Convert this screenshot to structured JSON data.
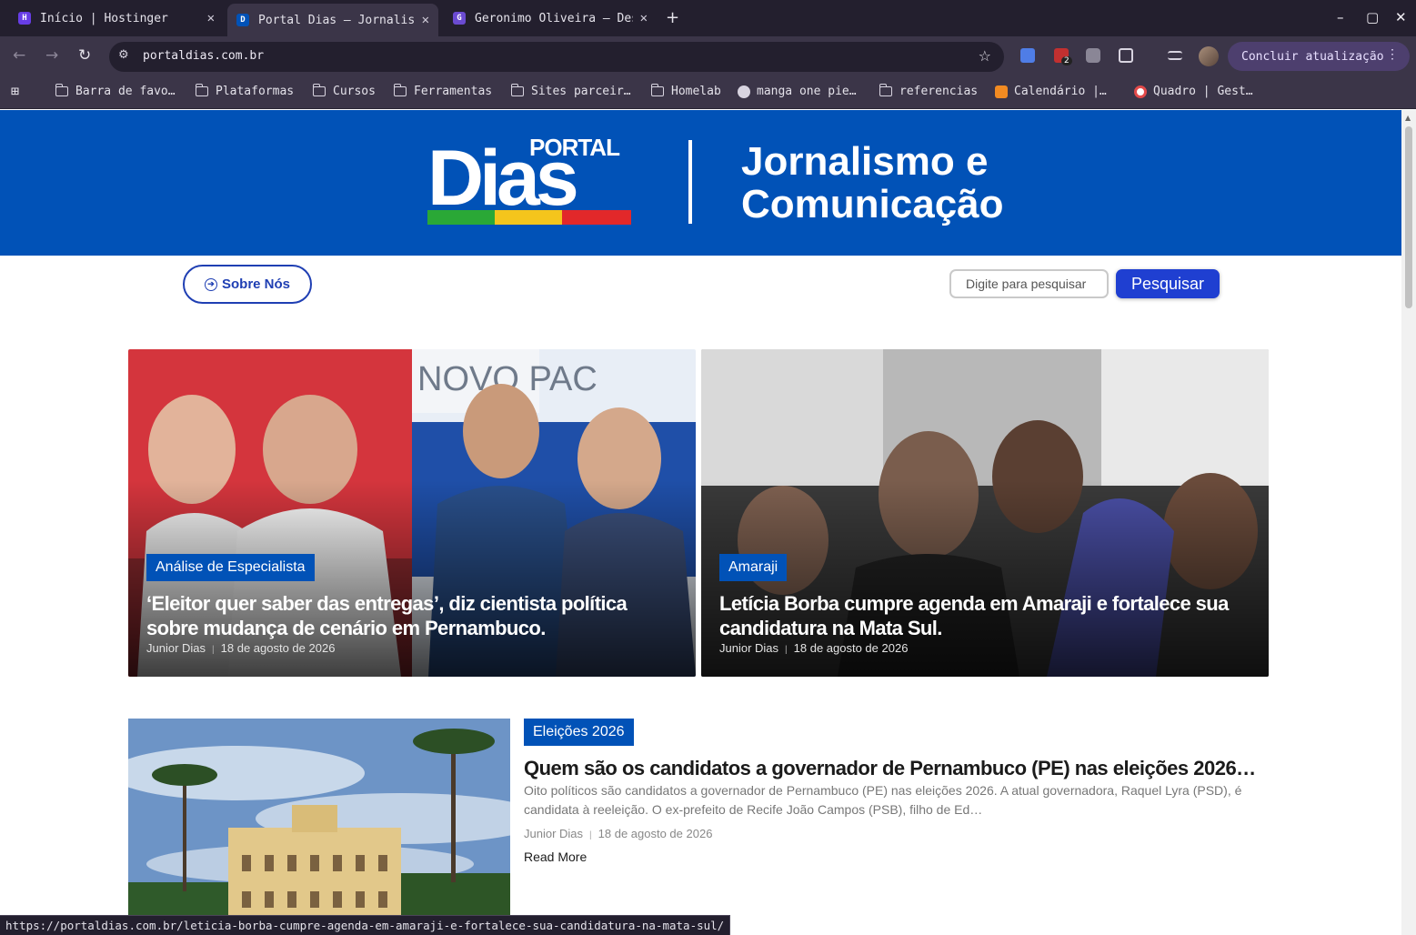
{
  "browser": {
    "tabs": [
      {
        "title": "Início | Hostinger",
        "favicon_color": "#673de6",
        "favicon_icon": "hostinger-icon"
      },
      {
        "title": "Portal Dias – Jornalismo e Comunicação",
        "favicon_color": "#0152b7",
        "favicon_icon": "portal-dias-icon"
      },
      {
        "title": "Geronimo Oliveira – Desenvolvedor",
        "favicon_color": "#6b4bd1",
        "favicon_icon": "go-icon"
      }
    ],
    "new_tab": "+",
    "window_controls": {
      "minimize": "–",
      "maximize": "▢",
      "close": "✕"
    },
    "address": "portaldias.com.br",
    "extension_badge": "2",
    "update_button": "Concluir atualização",
    "bookmarks": [
      {
        "label": "Barra de favo…",
        "icon": "folder-icon"
      },
      {
        "label": "Plataformas",
        "icon": "folder-icon"
      },
      {
        "label": "Cursos",
        "icon": "folder-icon"
      },
      {
        "label": "Ferramentas",
        "icon": "folder-icon"
      },
      {
        "label": "Sites parceir…",
        "icon": "folder-icon"
      },
      {
        "label": "Homelab",
        "icon": "folder-icon"
      },
      {
        "label": "manga one pie…",
        "icon": "globe-icon"
      },
      {
        "label": "referencias",
        "icon": "folder-icon"
      },
      {
        "label": "Calendário |…",
        "icon": "calendar-icon"
      },
      {
        "label": "Quadro | Gest…",
        "icon": "board-icon"
      }
    ],
    "status_url": "https://portaldias.com.br/leticia-borba-cumpre-agenda-em-amaraji-e-fortalece-sua-candidatura-na-mata-sul/"
  },
  "site": {
    "logo_word": "Dias",
    "logo_small": "PORTAL",
    "tagline_line1": "Jornalismo e",
    "tagline_line2": "Comunicação",
    "brand_color": "#0152b7",
    "about_button": "Sobre Nós",
    "search_placeholder": "Digite para pesquisar",
    "search_button": "Pesquisar"
  },
  "featured": [
    {
      "category": "Análise de Especialista",
      "headline": "‘Eleitor quer saber das entregas’, diz cientista política sobre mudança de cenário em Pernambuco.",
      "author": "Junior Dias",
      "date": "18 de agosto de 2026",
      "image_text": "NOVO PAC"
    },
    {
      "category": "Amaraji",
      "headline": "Letícia Borba cumpre agenda em Amaraji e fortalece sua candidatura na Mata Sul.",
      "author": "Junior Dias",
      "date": "18 de agosto de 2026"
    }
  ],
  "post": {
    "category": "Eleições 2026",
    "title": "Quem são os candidatos a governador de Pernambuco (PE) nas eleições 2026…",
    "excerpt": "Oito políticos são candidatos a governador de Pernambuco (PE) nas eleições 2026. A atual governadora, Raquel Lyra (PSD), é candidata à reeleição. O ex-prefeito de Recife João Campos (PSB), filho de Ed…",
    "author": "Junior Dias",
    "date": "18 de agosto de 2026",
    "read_more": "Read More"
  }
}
